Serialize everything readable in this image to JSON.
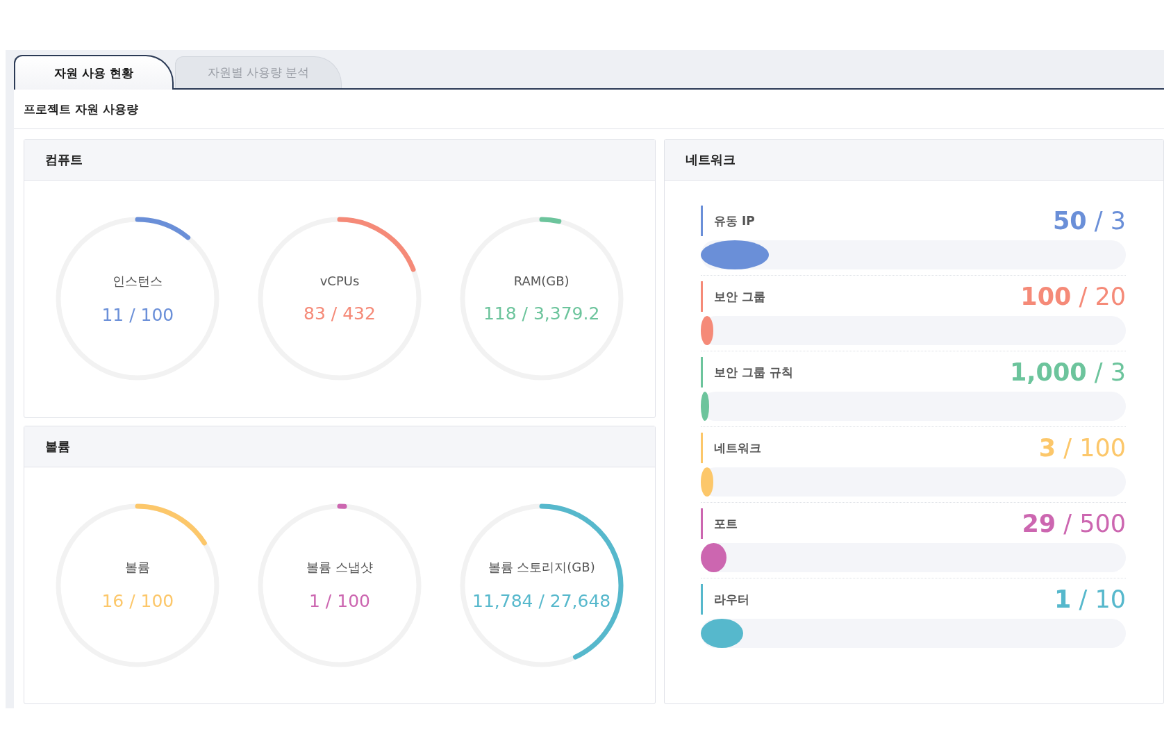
{
  "tabs": [
    {
      "label": "자원 사용 현황",
      "selected": true
    },
    {
      "label": "자원별 사용량 분석",
      "selected": false
    }
  ],
  "page_title": "프로젝트 자원 사용량",
  "compute": {
    "title": "컴퓨트",
    "gauges": [
      {
        "label": "인스턴스",
        "value": "11 / 100",
        "level": 0.11,
        "color": "#6a8fd8"
      },
      {
        "label": "vCPUs",
        "value": "83 / 432",
        "level": 0.19,
        "color": "#f58a78"
      },
      {
        "label": "RAM(GB)",
        "value": "118 / 3,379.2",
        "level": 0.035,
        "color": "#6cc49c"
      }
    ]
  },
  "volume": {
    "title": "볼륨",
    "gauges": [
      {
        "label": "볼륨",
        "value": "16 / 100",
        "level": 0.16,
        "color": "#fcc76a"
      },
      {
        "label": "볼륨 스냅샷",
        "value": "1 / 100",
        "level": 0.01,
        "color": "#cc66b0"
      },
      {
        "label": "볼륨 스토리지(GB)",
        "value": "11,784 / 27,648",
        "level": 0.43,
        "color": "#56b8cc"
      }
    ]
  },
  "network": {
    "title": "네트워크",
    "items": [
      {
        "label": "유동 IP",
        "value": "**50** / 3",
        "level": 0.16,
        "color": "#6a8fd8"
      },
      {
        "label": "보안 그룹",
        "value": "**100** / 20",
        "level": 0.03,
        "color": "#f58a78"
      },
      {
        "label": "보안 그룹 규칙",
        "value": "**1,000** / 3",
        "level": 0.02,
        "color": "#6cc49c"
      },
      {
        "label": "네트워크",
        "value": "**3** / 100",
        "level": 0.03,
        "color": "#fcc76a"
      },
      {
        "label": "포트",
        "value": "**29** / 500",
        "level": 0.06,
        "color": "#cc66b0"
      },
      {
        "label": "라우터",
        "value": "**1** / 10",
        "level": 0.1,
        "color": "#56b8cc"
      }
    ]
  }
}
